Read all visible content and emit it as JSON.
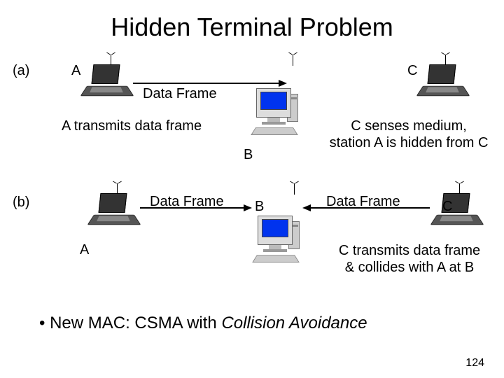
{
  "title": "Hidden Terminal Problem",
  "scenario_a": {
    "marker": "(a)",
    "label_A": "A",
    "label_C": "C",
    "label_B": "B",
    "data_frame": "Data Frame",
    "caption_left": "A transmits data frame",
    "caption_right_line1": "C senses medium,",
    "caption_right_line2": "station A is hidden from C"
  },
  "scenario_b": {
    "marker": "(b)",
    "label_A": "A",
    "label_B": "B",
    "label_C": "C",
    "data_frame_left": "Data Frame",
    "data_frame_right": "Data Frame",
    "caption_right_line1": "C transmits data frame",
    "caption_right_line2": "& collides with A at B"
  },
  "bullet_prefix": "•  New MAC:  CSMA with ",
  "bullet_italic": "Collision Avoidance",
  "page_number": "124"
}
